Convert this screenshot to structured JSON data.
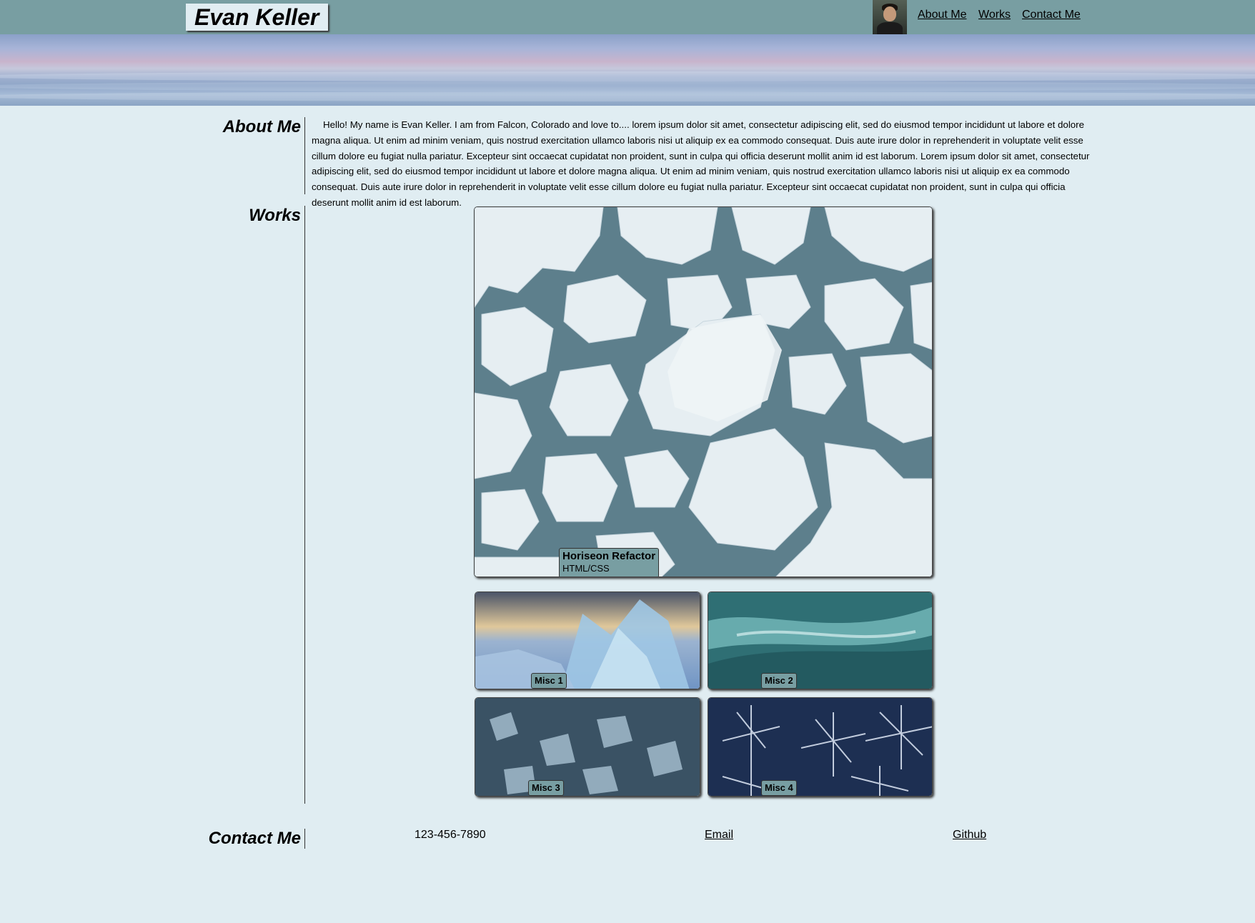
{
  "header": {
    "logo": "Evan Keller",
    "nav": [
      "About Me",
      "Works",
      "Contact Me"
    ]
  },
  "about": {
    "title": "About Me",
    "text": "Hello! My name is Evan Keller. I am from Falcon, Colorado and love to.... lorem ipsum dolor sit amet, consectetur adipiscing elit, sed do eiusmod tempor incididunt ut labore et dolore magna aliqua. Ut enim ad minim veniam, quis nostrud exercitation ullamco laboris nisi ut aliquip ex ea commodo consequat. Duis aute irure dolor in reprehenderit in voluptate velit esse cillum dolore eu fugiat nulla pariatur. Excepteur sint occaecat cupidatat non proident, sunt in culpa qui officia deserunt mollit anim id est laborum. Lorem ipsum dolor sit amet, consectetur adipiscing elit, sed do eiusmod tempor incididunt ut labore et dolore magna aliqua. Ut enim ad minim veniam, quis nostrud exercitation ullamco laboris nisi ut aliquip ex ea commodo consequat. Duis aute irure dolor in reprehenderit in voluptate velit esse cillum dolore eu fugiat nulla pariatur. Excepteur sint occaecat cupidatat non proident, sunt in culpa qui officia deserunt mollit anim id est laborum."
  },
  "works": {
    "title": "Works",
    "featured": {
      "name": "Horiseon Refactor",
      "tech": "HTML/CSS"
    },
    "misc": [
      "Misc 1",
      "Misc 2",
      "Misc 3",
      "Misc 4"
    ]
  },
  "contact": {
    "title": "Contact Me",
    "phone": "123-456-7890",
    "email": "Email",
    "github": "Github"
  },
  "colors": {
    "header_bg": "#789ea2",
    "page_bg": "#e0edf2",
    "label_bg": "#789ea2"
  }
}
